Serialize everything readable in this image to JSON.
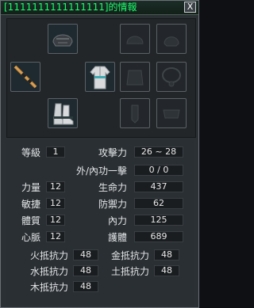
{
  "window": {
    "title": "[1111111111111111]的情報",
    "close_label": "X"
  },
  "equipment": {
    "slots": [
      {
        "name": "helmet-slot",
        "icon": "helmet-icon",
        "filled": true
      },
      {
        "name": "top-right-slot-1",
        "icon": "empty-slot-icon",
        "filled": false
      },
      {
        "name": "top-right-slot-2",
        "icon": "empty-slot-icon",
        "filled": false
      },
      {
        "name": "necklace-slot",
        "icon": "empty-slot-icon",
        "filled": false
      },
      {
        "name": "weapon-slot",
        "icon": "spear-icon",
        "filled": true
      },
      {
        "name": "armor-slot",
        "icon": "robe-icon",
        "filled": true
      },
      {
        "name": "mid-right-slot-1",
        "icon": "empty-slot-icon",
        "filled": false
      },
      {
        "name": "mid-right-slot-2",
        "icon": "empty-slot-icon",
        "filled": false
      },
      {
        "name": "boots-slot",
        "icon": "boots-icon",
        "filled": true
      },
      {
        "name": "bottom-right-slot-1",
        "icon": "empty-slot-icon",
        "filled": false
      },
      {
        "name": "bottom-right-slot-2",
        "icon": "empty-slot-icon",
        "filled": false
      }
    ]
  },
  "stats": {
    "level": {
      "label": "等級",
      "value": "1"
    },
    "attack": {
      "label": "攻擊力",
      "value": "26 ~ 28"
    },
    "martial": {
      "label": "外/內功一擊",
      "value": "0 / 0"
    },
    "strength": {
      "label": "力量",
      "value": "12"
    },
    "hp": {
      "label": "生命力",
      "value": "437"
    },
    "agility": {
      "label": "敏捷",
      "value": "12"
    },
    "defense": {
      "label": "防禦力",
      "value": "62"
    },
    "constitution": {
      "label": "體質",
      "value": "12"
    },
    "inner_power": {
      "label": "內力",
      "value": "125"
    },
    "spirit": {
      "label": "心脈",
      "value": "12"
    },
    "protection": {
      "label": "護體",
      "value": "689"
    }
  },
  "resistances": {
    "fire": {
      "label": "火抵抗力",
      "value": "48"
    },
    "metal": {
      "label": "金抵抗力",
      "value": "48"
    },
    "water": {
      "label": "水抵抗力",
      "value": "48"
    },
    "earth": {
      "label": "土抵抗力",
      "value": "48"
    },
    "wood": {
      "label": "木抵抗力",
      "value": "48"
    }
  },
  "colors": {
    "title": "#18ff6a",
    "panel": "#2b3034",
    "value_box": "#1a1d20"
  }
}
